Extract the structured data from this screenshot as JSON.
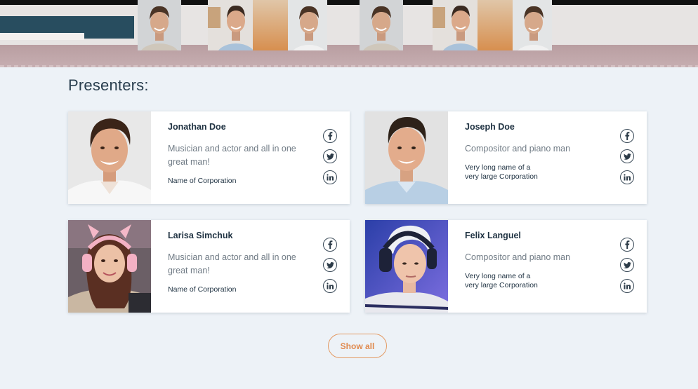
{
  "heading": "Presenters:",
  "presenters": [
    {
      "name": "Jonathan Doe",
      "role": "Musician and actor and all in one great man!",
      "corporation": "Name of Corporation",
      "socials": [
        "facebook-icon",
        "twitter-icon",
        "linkedin-icon"
      ]
    },
    {
      "name": "Joseph Doe",
      "role": "Compositor and piano man",
      "corporation": "Very long name of a very large Corporation",
      "socials": [
        "facebook-icon",
        "twitter-icon",
        "linkedin-icon"
      ]
    },
    {
      "name": "Larisa Simchuk",
      "role": "Musician and actor and all in one great man!",
      "corporation": "Name of Corporation",
      "socials": [
        "facebook-icon",
        "twitter-icon",
        "linkedin-icon"
      ]
    },
    {
      "name": "Felix Languel",
      "role": "Compositor and piano man",
      "corporation": "Very long name of a very large Corporation",
      "socials": [
        "facebook-icon",
        "twitter-icon",
        "linkedin-icon"
      ]
    }
  ],
  "show_all_label": "Show all",
  "colors": {
    "accent": "#e08a4f",
    "text_dark": "#1f3242",
    "text_muted": "#707b85",
    "background": "#edf2f7",
    "banner_block": "#284d5f"
  }
}
